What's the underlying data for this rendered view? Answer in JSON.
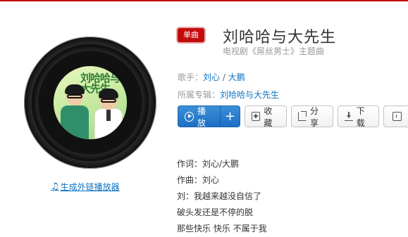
{
  "badge": "单曲",
  "song": {
    "title": "刘哈哈与大先生",
    "subtitle": "电视剧《屌丝男士》主题曲"
  },
  "singer": {
    "label": "歌手：",
    "names": [
      "刘心",
      "大鹏"
    ],
    "separator": " / "
  },
  "album": {
    "label": "所属专辑：",
    "name": "刘哈哈与大先生"
  },
  "cover": {
    "art_text": "刘哈哈与大先生"
  },
  "actions": {
    "play": "播放",
    "add": "+",
    "favorite": "收藏",
    "share": "分享",
    "download": "下载"
  },
  "external_link": "生成外链播放器",
  "lyrics": [
    "作词：刘心/大鹏",
    "作曲：刘心",
    "刘：我越来越没自信了",
    "破头发还是不停的脱",
    "那些快乐 快乐 不属于我"
  ],
  "colors": {
    "accent_red": "#c20c0c",
    "link_blue": "#0c73c2",
    "play_blue": "#2a7fd0"
  }
}
